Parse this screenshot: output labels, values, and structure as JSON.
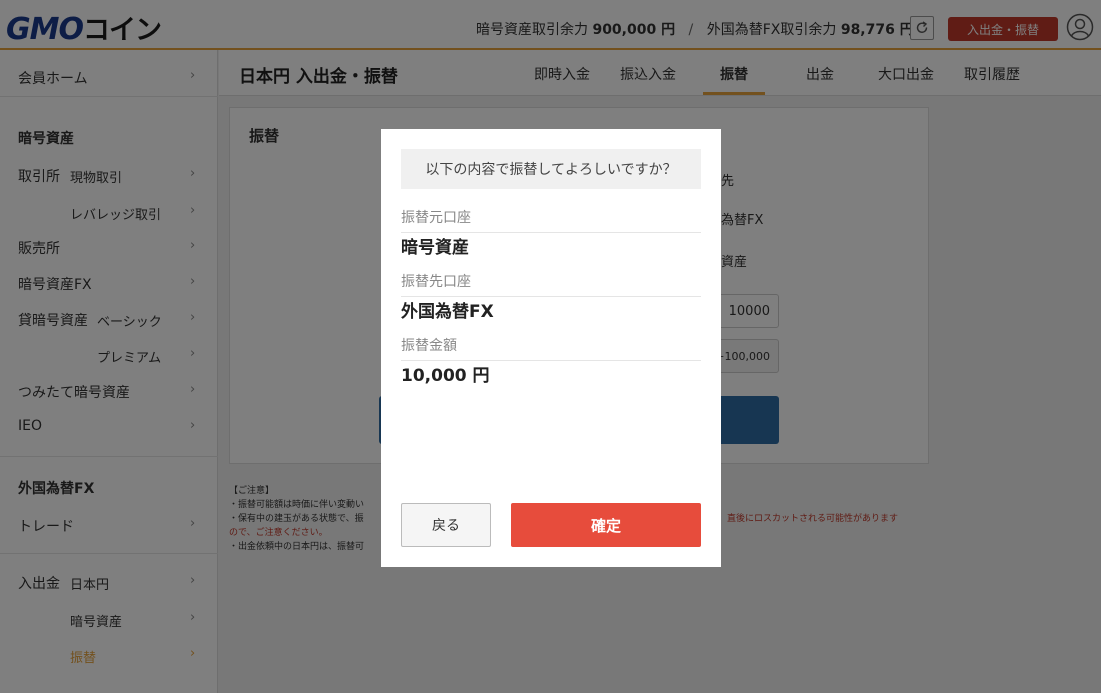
{
  "header": {
    "logo_main": "GMO",
    "logo_sub": "コイン",
    "crypto_label": "暗号資産取引余力",
    "crypto_value": "900,000 円",
    "separator": "/",
    "fx_label": "外国為替FX取引余力",
    "fx_value": "98,776 円",
    "deposit_button": "入出金・振替",
    "accent_color": "#e6a23c",
    "brand_color": "#1b3a8c"
  },
  "sidebar": {
    "member_home": "会員ホーム",
    "crypto_heading": "暗号資産",
    "exchange": "取引所",
    "spot": "現物取引",
    "leverage": "レバレッジ取引",
    "sales": "販売所",
    "crypto_fx": "暗号資産FX",
    "lending": "貸暗号資産",
    "basic": "ベーシック",
    "premium": "プレミアム",
    "tsumitate": "つみたて暗号資産",
    "ieo": "IEO",
    "fx_heading": "外国為替FX",
    "trade": "トレード",
    "deposit": "入出金",
    "jpy": "日本円",
    "crypto_asset": "暗号資産",
    "transfer": "振替"
  },
  "main": {
    "page_title": "日本円 入出金・振替",
    "tabs": [
      {
        "label": "即時入金"
      },
      {
        "label": "振込入金"
      },
      {
        "label": "振替"
      },
      {
        "label": "出金"
      },
      {
        "label": "大口出金"
      },
      {
        "label": "取引履歴"
      }
    ],
    "card_title": "振替",
    "bg_fragments": {
      "f1": "先",
      "f2": "為替FX",
      "f3": "資産",
      "amount_value": "10000",
      "quick_add": "+100,000"
    }
  },
  "notes": {
    "heading": "【ご注意】",
    "line1": "・振替可能額は時価に伴い変動い",
    "line2": "・保有中の建玉がある状態で、振",
    "line2_red": "直後にロスカットされる可能性があります",
    "line3_red": "ので、ご注意ください。",
    "line4": "・出金依頼中の日本円は、振替可"
  },
  "modal": {
    "question": "以下の内容で振替してよろしいですか？",
    "from_label": "振替元口座",
    "from_value": "暗号資産",
    "to_label": "振替先口座",
    "to_value": "外国為替FX",
    "amount_label": "振替金額",
    "amount_value": "10,000 円",
    "back_button": "戻る",
    "confirm_button": "確定",
    "confirm_color": "#e74c3c"
  }
}
